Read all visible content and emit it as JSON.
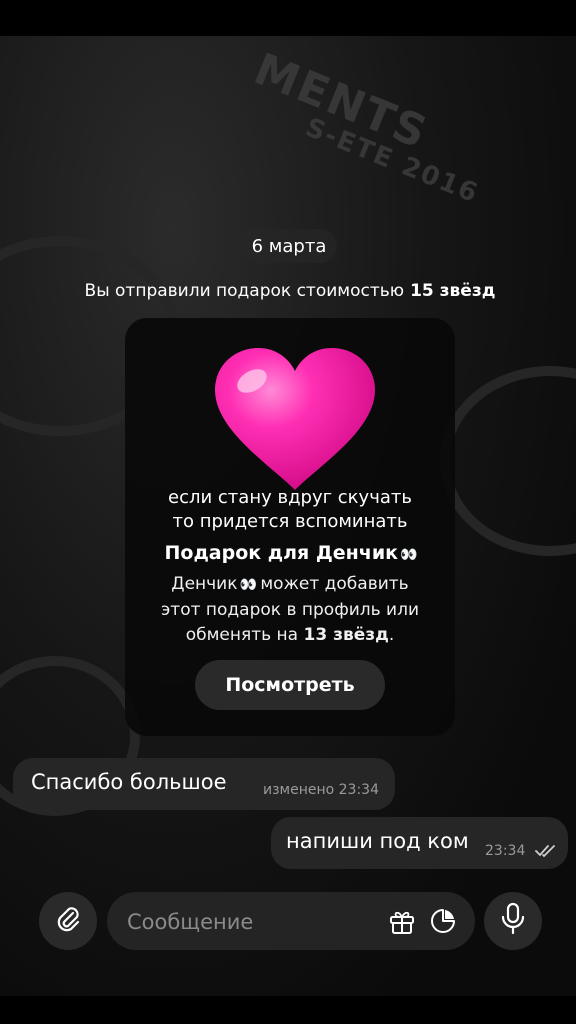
{
  "chat": {
    "date": "6 марта",
    "service_message": {
      "prefix": "Вы отправили подарок стоимостью",
      "amount": "15 звёзд"
    },
    "gift": {
      "icon": "pink-heart-emoji",
      "overlay_caption_line1": "если стану вдруг скучать",
      "overlay_caption_line2": "то придется вспоминать",
      "title": "Подарок для Денчик",
      "desc_name": "Денчик",
      "desc_part1": "может добавить",
      "desc_line2": "этот подарок в профиль или",
      "desc_line3_prefix": "обменять на",
      "desc_line3_amount": "13 звёзд",
      "desc_line3_suffix": ".",
      "view_button": "Посмотреть"
    },
    "messages": [
      {
        "direction": "incoming",
        "text": "Спасибо большое",
        "meta": "изменено 23:34"
      },
      {
        "direction": "outgoing",
        "text": "напиши под ком",
        "time": "23:34",
        "status": "read"
      }
    ]
  },
  "composer": {
    "placeholder": "Сообщение",
    "attach_icon": "paperclip-icon",
    "gift_icon": "gift-icon",
    "sticker_icon": "sticker-icon",
    "mic_icon": "microphone-icon"
  },
  "wallpaper": {
    "text_line1": "MENTS",
    "text_line2": "S-ETE 2016"
  },
  "colors": {
    "background": "#000000",
    "bubble": "#262626",
    "heart": "#ff1aa8",
    "muted_text": "#9a9a9a"
  }
}
